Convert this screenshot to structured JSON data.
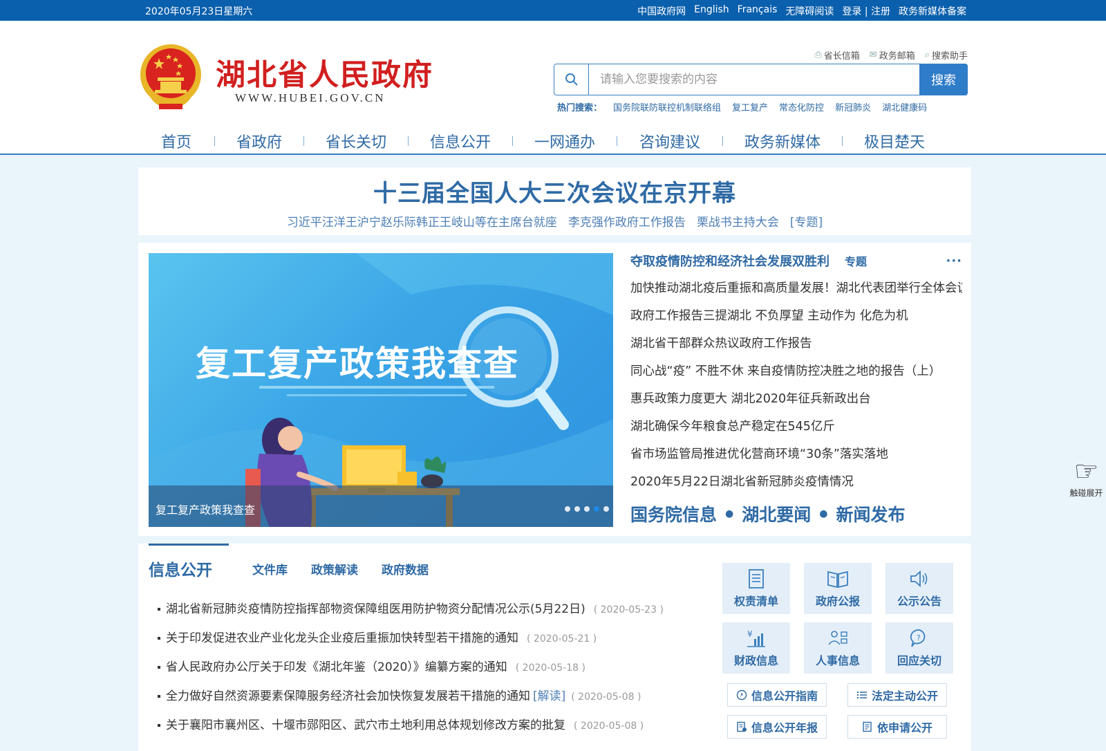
{
  "topbar": {
    "date": "2020年05月23日星期六",
    "links": [
      "中国政府网",
      "English",
      "Français",
      "无障碍阅读",
      "登录 | 注册",
      "政务新媒体备案"
    ]
  },
  "header": {
    "title": "湖北省人民政府",
    "domain": "WWW.HUBEI.GOV.CN",
    "tools": [
      "省长信箱",
      "政务邮箱",
      "搜索助手"
    ]
  },
  "search": {
    "placeholder": "请输入您要搜索的内容",
    "button": "搜索",
    "hot_label": "热门搜索：",
    "hot_keywords": [
      "国务院联防联控机制联络组",
      "复工复产",
      "常态化防控",
      "新冠肺炎",
      "湖北健康码"
    ]
  },
  "nav": [
    "首页",
    "省政府",
    "省长关切",
    "信息公开",
    "一网通办",
    "咨询建议",
    "政务新媒体",
    "极目楚天"
  ],
  "headline": {
    "title": "十三届全国人大三次会议在京开幕",
    "subs": [
      "习近平汪洋王沪宁赵乐际韩正王岐山等在主席台就座",
      "李克强作政府工作报告",
      "栗战书主持大会",
      "[专题]"
    ]
  },
  "banner": {
    "title": "复工复产政策我查查",
    "caption": "复工复产政策我查查"
  },
  "news": {
    "title": "夺取疫情防控和经济社会发展双胜利",
    "special": "专题",
    "more": "···",
    "items": [
      "加快推动湖北疫后重振和高质量发展！湖北代表团举行全体会议",
      "政府工作报告三提湖北 不负厚望 主动作为 化危为机",
      "湖北省干部群众热议政府工作报告",
      "同心战“疫” 不胜不休 来自疫情防控决胜之地的报告（上）",
      "惠兵政策力度更大 湖北2020年征兵新政出台",
      "湖北确保今年粮食总产稳定在545亿斤",
      "省市场监管局推进优化营商环境“30条”落实落地",
      "2020年5月22日湖北省新冠肺炎疫情情况"
    ],
    "big_links": [
      "国务院信息",
      "湖北要闻",
      "新闻发布"
    ]
  },
  "info": {
    "main_tab": "信息公开",
    "tabs": [
      "文件库",
      "政策解读",
      "政府数据"
    ],
    "items": [
      {
        "title": "湖北省新冠肺炎疫情防控指挥部物资保障组医用防护物资分配情况公示(5月22日)",
        "tag": "",
        "date": "( 2020-05-23 )"
      },
      {
        "title": "关于印发促进农业产业化龙头企业疫后重振加快转型若干措施的通知",
        "tag": "",
        "date": "( 2020-05-21 )"
      },
      {
        "title": "省人民政府办公厅关于印发《湖北年鉴（2020）》编纂方案的通知",
        "tag": "",
        "date": "( 2020-05-18 )"
      },
      {
        "title": "全力做好自然资源要素保障服务经济社会加快恢复发展若干措施的通知",
        "tag": "[解读]",
        "date": "( 2020-05-08 )"
      },
      {
        "title": "关于襄阳市襄州区、十堰市郧阳区、武穴市土地利用总体规划修改方案的批复",
        "tag": "",
        "date": "( 2020-05-08 )"
      }
    ],
    "tiles": [
      {
        "label": "权责清单",
        "icon": "list-icon"
      },
      {
        "label": "政府公报",
        "icon": "book-icon"
      },
      {
        "label": "公示公告",
        "icon": "speaker-icon"
      },
      {
        "label": "财政信息",
        "icon": "finance-chart-icon"
      },
      {
        "label": "人事信息",
        "icon": "people-icon"
      },
      {
        "label": "回应关切",
        "icon": "question-bubble-icon"
      }
    ],
    "pills": [
      {
        "label": "信息公开指南",
        "icon": "compass-icon"
      },
      {
        "label": "法定主动公开",
        "icon": "list-bullets-icon"
      },
      {
        "label": "信息公开年报",
        "icon": "report-icon"
      },
      {
        "label": "依申请公开",
        "icon": "form-icon"
      }
    ]
  },
  "side": {
    "label": "触碰展开",
    "icon": "pointing-hand-icon"
  },
  "colors": {
    "primary": "#0b60ad",
    "accent": "#2f6aa5",
    "title_red": "#d11f1f",
    "page_bg": "#eaf4fb"
  }
}
